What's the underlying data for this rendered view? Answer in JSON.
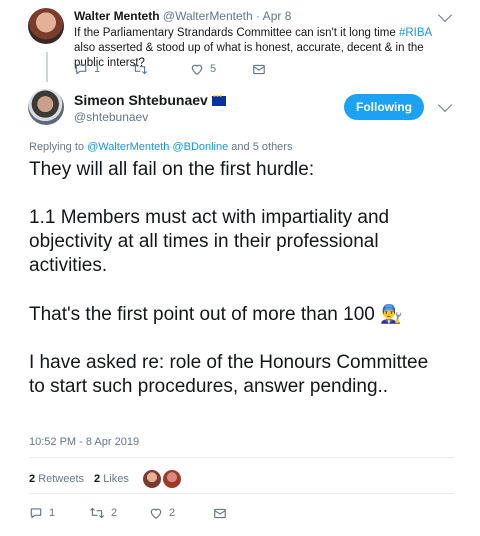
{
  "reply_tweet": {
    "name": "Walter Menteth",
    "handle": "@WalterMenteth",
    "date": "· Apr 8",
    "text_before": "If the Parliamentary Strandards Committee can isn't it long time ",
    "hashtag": "#RIBA",
    "text_after": " also asserted & stood up of what is honest, accurate, decent & in the public interst?",
    "reply_count": "1",
    "retweet_count": "",
    "like_count": "5"
  },
  "main_tweet": {
    "name": "Simeon Shtebunaev",
    "handle": "@shtebunaev",
    "follow_label": "Following",
    "replying_prefix": "Replying to ",
    "replying_to": "@WalterMenteth @BDonline",
    "replying_suffix": " and 5 others",
    "paragraphs": [
      "They will all fail on the first hurdle:",
      "1.1 Members must act with impartiality and objectivity at all times in their professional activities.",
      "That's the first point out of more than 100",
      "I have asked re: role of the Honours Committee to start such procedures, answer pending.."
    ],
    "emoji": "👨‍🔧",
    "timestamp": "10:52 PM - 8 Apr 2019",
    "retweets_count": "2",
    "retweets_label": "Retweets",
    "likes_count": "2",
    "likes_label": "Likes",
    "reply_count": "1",
    "retweet_count": "2",
    "like_count": "2"
  },
  "colors": {
    "accent": "#1da1f2",
    "link": "#1b95e0",
    "muted": "#657786"
  }
}
